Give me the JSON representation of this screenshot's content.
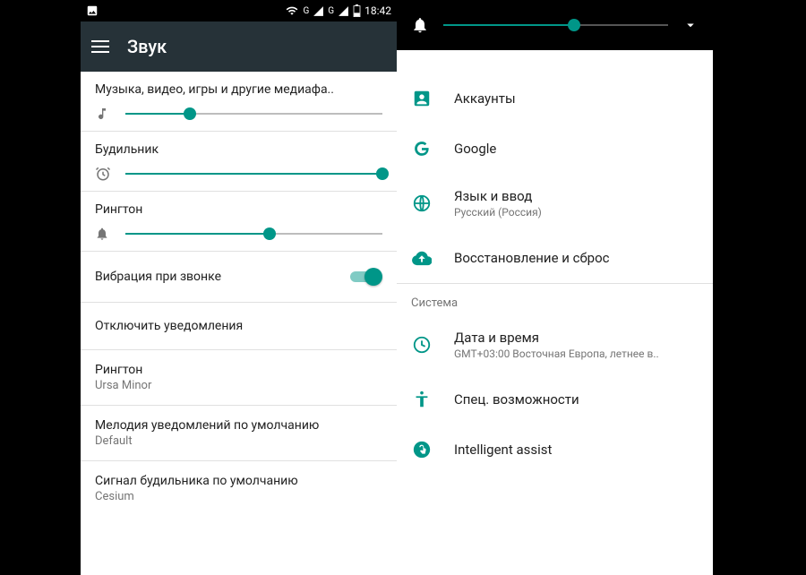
{
  "statusbar": {
    "time": "18:42",
    "net_label_g": "G"
  },
  "left": {
    "title": "Звук",
    "sliders": {
      "media": {
        "label": "Музыка, видео, игры и другие медиафа..",
        "value": 25
      },
      "alarm": {
        "label": "Будильник",
        "value": 100
      },
      "ring": {
        "label": "Рингтон",
        "value": 56
      }
    },
    "vibrate": {
      "label": "Вибрация при звонке",
      "on": true
    },
    "mute_notifications": "Отключить уведомления",
    "ringtone": {
      "label": "Рингтон",
      "value": "Ursa Minor"
    },
    "notif_sound": {
      "label": "Мелодия уведомлений по умолчанию",
      "value": "Default"
    },
    "alarm_sound": {
      "label": "Сигнал будильника по умолчанию",
      "value": "Cesium"
    }
  },
  "right": {
    "top_slider_value": 58,
    "items": {
      "accounts": {
        "label": "Аккаунты"
      },
      "google": {
        "label": "Google"
      },
      "language": {
        "label": "Язык и ввод",
        "value": "Русский (Россия)"
      },
      "backup": {
        "label": "Восстановление и сброс"
      }
    },
    "section": "Система",
    "system": {
      "datetime": {
        "label": "Дата и время",
        "value": "GMT+03:00 Восточная Европа, летнее в.."
      },
      "accessibility": {
        "label": "Спец. возможности"
      },
      "assist": {
        "label": "Intelligent assist"
      }
    }
  }
}
